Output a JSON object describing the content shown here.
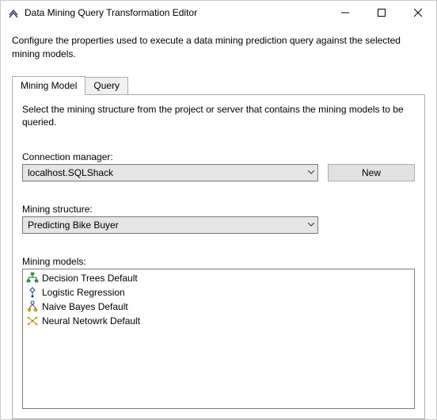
{
  "window": {
    "title": "Data Mining Query Transformation Editor"
  },
  "description": "Configure the properties used to execute a data mining prediction query against the selected mining models.",
  "tabs": {
    "mining_model": "Mining Model",
    "query": "Query"
  },
  "panel": {
    "instruction": "Select the mining structure from the project or server that contains the mining models to be queried.",
    "connection_label": "Connection manager:",
    "connection_value": "localhost.SQLShack",
    "new_button": "New",
    "structure_label": "Mining structure:",
    "structure_value": "Predicting Bike Buyer",
    "models_label": "Mining models:",
    "models": [
      {
        "icon": "decision-trees-icon",
        "label": "Decision Trees Default"
      },
      {
        "icon": "logistic-regression-icon",
        "label": "Logistic Regression"
      },
      {
        "icon": "naive-bayes-icon",
        "label": "Naive Bayes Default"
      },
      {
        "icon": "neural-network-icon",
        "label": "Neural Netowrk Default"
      }
    ]
  }
}
